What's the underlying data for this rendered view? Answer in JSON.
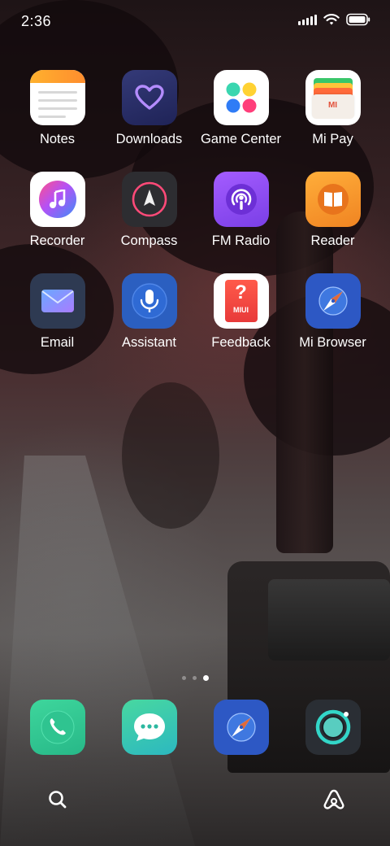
{
  "status_bar": {
    "time": "2:36",
    "signal_icon": "signal-icon",
    "wifi_icon": "wifi-icon",
    "battery_icon": "battery-icon"
  },
  "apps": [
    {
      "label": "Notes",
      "icon": "notes-icon"
    },
    {
      "label": "Downloads",
      "icon": "downloads-heart-icon"
    },
    {
      "label": "Game Center",
      "icon": "game-center-dots-icon"
    },
    {
      "label": "Mi Pay",
      "icon": "mi-pay-wallet-icon",
      "badge": "MI"
    },
    {
      "label": "Recorder",
      "icon": "recorder-music-note-icon"
    },
    {
      "label": "Compass",
      "icon": "compass-arrow-icon"
    },
    {
      "label": "FM Radio",
      "icon": "fm-radio-podcast-icon"
    },
    {
      "label": "Reader",
      "icon": "reader-book-icon"
    },
    {
      "label": "Email",
      "icon": "email-envelope-icon"
    },
    {
      "label": "Assistant",
      "icon": "assistant-mic-icon"
    },
    {
      "label": "Feedback",
      "icon": "feedback-question-icon",
      "badge": "MIUI"
    },
    {
      "label": "Mi Browser",
      "icon": "mi-browser-compass-icon"
    }
  ],
  "dock": [
    {
      "name": "phone",
      "icon": "phone-icon"
    },
    {
      "name": "messages",
      "icon": "messages-bubble-icon"
    },
    {
      "name": "browser",
      "icon": "browser-compass-icon"
    },
    {
      "name": "camera",
      "icon": "camera-lens-icon"
    }
  ],
  "page_indicator": {
    "pages": 3,
    "current": 3
  },
  "bottom_bar": {
    "search_icon": "search-icon",
    "assistant_icon": "assistant-a-icon"
  },
  "colors": {
    "downloads_bg": "#2b2f6b",
    "fm_radio_bg": "#8a4bef",
    "reader_bg": "#f39a2a",
    "assistant_bg": "#2b5fc0",
    "browser_bg": "#2d58c4",
    "phone_bg": "#34c98e",
    "messages_bg": "#3ac6a0",
    "camera_bg": "#2a2e34"
  }
}
